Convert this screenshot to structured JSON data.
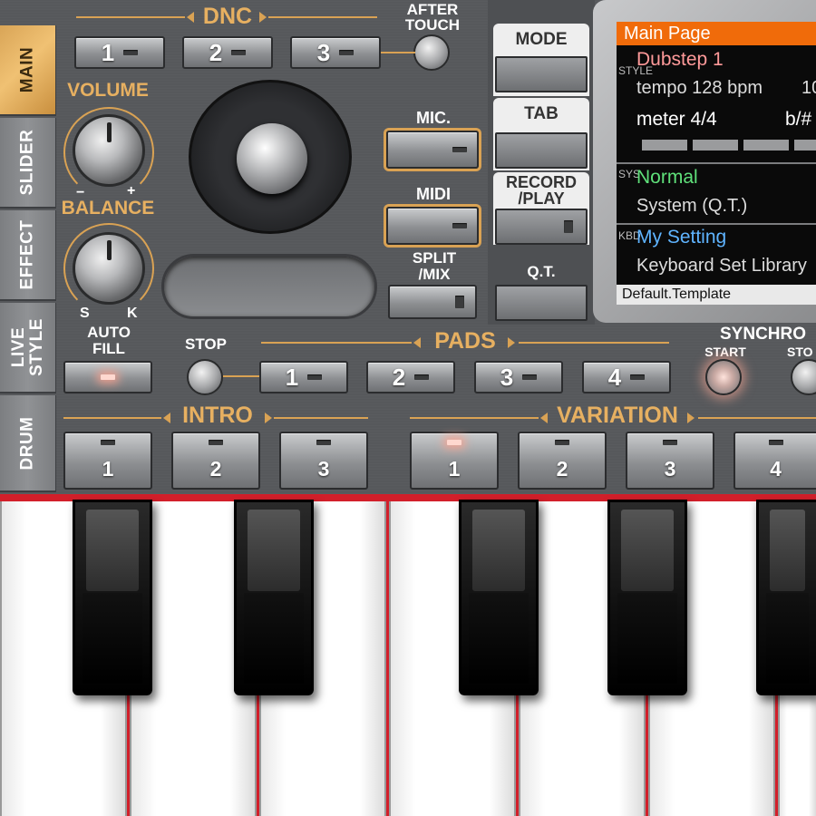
{
  "side_tabs": [
    "MAIN",
    "SLIDER",
    "EFFECT",
    "LIVE STYLE",
    "DRUM"
  ],
  "dnc": {
    "title": "DNC",
    "buttons": [
      "1",
      "2",
      "3"
    ]
  },
  "after_touch": "AFTER TOUCH",
  "volume": {
    "label": "VOLUME",
    "min": "−",
    "max": "+"
  },
  "balance": {
    "label": "BALANCE",
    "left": "S",
    "right": "K"
  },
  "mic_label": "MIC.",
  "midi_label": "MIDI",
  "split_mix_label": "SPLIT /MIX",
  "mode_column": {
    "mode": "MODE",
    "tab": "TAB",
    "record_play": "RECORD /PLAY",
    "qt": "Q.T."
  },
  "screen": {
    "header": "Main Page",
    "style_tag": "STYLE",
    "sys_tag": "SYS",
    "kbd_tag": "KBD",
    "style_name": "Dubstep 1",
    "tempo": "tempo 128 bpm",
    "tempo_extra": "10",
    "meter": "meter 4/4",
    "meter_extra": "b/#",
    "sys_name": "Normal",
    "sys_sub": "System (Q.T.)",
    "kbd_name": "My Setting",
    "kbd_sub": "Keyboard Set Library",
    "footer": "Default.Template",
    "colors": {
      "header": "#f06b0a",
      "style_name": "#ff9a9a",
      "sys_name": "#5fe07a",
      "kbd_name": "#5fb4ff"
    }
  },
  "auto_fill": "AUTO FILL",
  "stop": "STOP",
  "pads": {
    "title": "PADS",
    "buttons": [
      "1",
      "2",
      "3",
      "4"
    ]
  },
  "synchro": {
    "title": "SYNCHRO",
    "start": "START",
    "stop": "STO"
  },
  "intro": {
    "title": "INTRO",
    "buttons": [
      "1",
      "2",
      "3"
    ]
  },
  "variation": {
    "title": "VARIATION",
    "buttons": [
      "1",
      "2",
      "3",
      "4"
    ]
  }
}
